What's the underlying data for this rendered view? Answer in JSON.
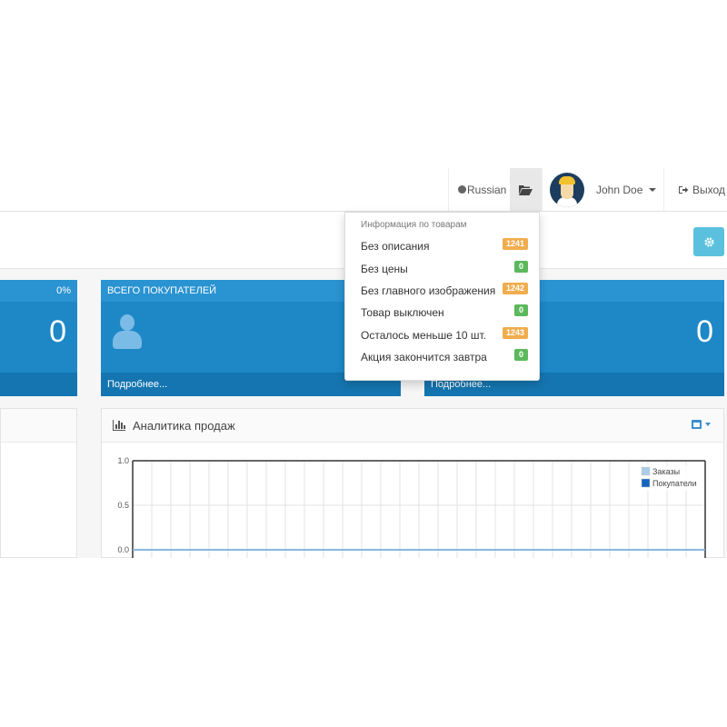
{
  "header": {
    "language": "Russian",
    "user_name": "John Doe",
    "logout": "Выход"
  },
  "tiles": [
    {
      "title": "",
      "percent": "0%",
      "value": "0",
      "footer": ""
    },
    {
      "title": "ВСЕГО ПОКУПАТЕЛЕЙ",
      "value": "",
      "footer": "Подробнее..."
    },
    {
      "title": "",
      "value": "0",
      "footer": "Подробнее..."
    }
  ],
  "dropdown": {
    "header": "Информация по товарам",
    "items": [
      {
        "label": "Без описания",
        "count": "1241",
        "color": "#f0ad4e"
      },
      {
        "label": "Без цены",
        "count": "0",
        "color": "#5cb85c"
      },
      {
        "label": "Без главного изображения",
        "count": "1242",
        "color": "#f0ad4e"
      },
      {
        "label": "Товар выключен",
        "count": "0",
        "color": "#5cb85c"
      },
      {
        "label": "Осталось меньше 10 шт.",
        "count": "1243",
        "color": "#f0ad4e"
      },
      {
        "label": "Акция закончится завтра",
        "count": "0",
        "color": "#5cb85c"
      }
    ]
  },
  "analytics": {
    "title": "Аналитика продаж"
  },
  "chart_data": {
    "type": "line",
    "ylim": [
      0,
      1.0
    ],
    "yticks": [
      "1.0",
      "0.5",
      "0.0"
    ],
    "grid": true,
    "legend_position": "top-right",
    "series": [
      {
        "name": "Заказы",
        "color": "#a9cde8",
        "values": [
          0,
          0,
          0,
          0,
          0,
          0,
          0,
          0,
          0,
          0,
          0,
          0,
          0,
          0,
          0,
          0,
          0,
          0,
          0,
          0,
          0,
          0,
          0,
          0,
          0,
          0,
          0,
          0,
          0,
          0,
          0
        ]
      },
      {
        "name": "Покупатели",
        "color": "#1565c0",
        "values": [
          0,
          0,
          0,
          0,
          0,
          0,
          0,
          0,
          0,
          0,
          0,
          0,
          0,
          0,
          0,
          0,
          0,
          0,
          0,
          0,
          0,
          0,
          0,
          0,
          0,
          0,
          0,
          0,
          0,
          0,
          0
        ]
      }
    ]
  }
}
